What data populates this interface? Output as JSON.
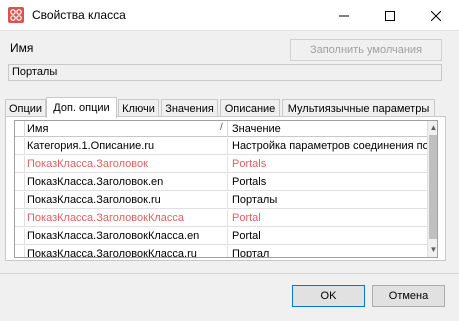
{
  "window": {
    "title": "Свойства класса",
    "minimize_icon": "minimize-icon",
    "maximize_icon": "maximize-icon",
    "close_icon": "close-icon"
  },
  "name_section": {
    "label": "Имя",
    "fill_defaults_label": "Заполнить умолчания",
    "value": "Порталы"
  },
  "tabs": [
    {
      "label": "Опции"
    },
    {
      "label": "Доп. опции"
    },
    {
      "label": "Ключи"
    },
    {
      "label": "Значения"
    },
    {
      "label": "Описание"
    },
    {
      "label": "Мультиязычные параметры"
    }
  ],
  "active_tab": 1,
  "grid": {
    "columns": [
      "Имя",
      "Значение"
    ],
    "sort_indicator": "/",
    "rows": [
      {
        "name": "Категория.1.Описание.ru",
        "value": "Настройка параметров соединения по",
        "highlight": false
      },
      {
        "name": "ПоказКласса.Заголовок",
        "value": "Portals",
        "highlight": true
      },
      {
        "name": "ПоказКласса.Заголовок.en",
        "value": "Portals",
        "highlight": false
      },
      {
        "name": "ПоказКласса.Заголовок.ru",
        "value": "Порталы",
        "highlight": false
      },
      {
        "name": "ПоказКласса.ЗаголовокКласса",
        "value": "Portal",
        "highlight": true
      },
      {
        "name": "ПоказКласса.ЗаголовокКласса.en",
        "value": "Portal",
        "highlight": false
      },
      {
        "name": "ПоказКласса.ЗаголовокКласса.ru",
        "value": "Портал",
        "highlight": false
      }
    ]
  },
  "buttons": {
    "ok": "OK",
    "cancel": "Отмена"
  },
  "colors": {
    "highlight_text": "#e06060",
    "focus_border": "#0078d7"
  }
}
